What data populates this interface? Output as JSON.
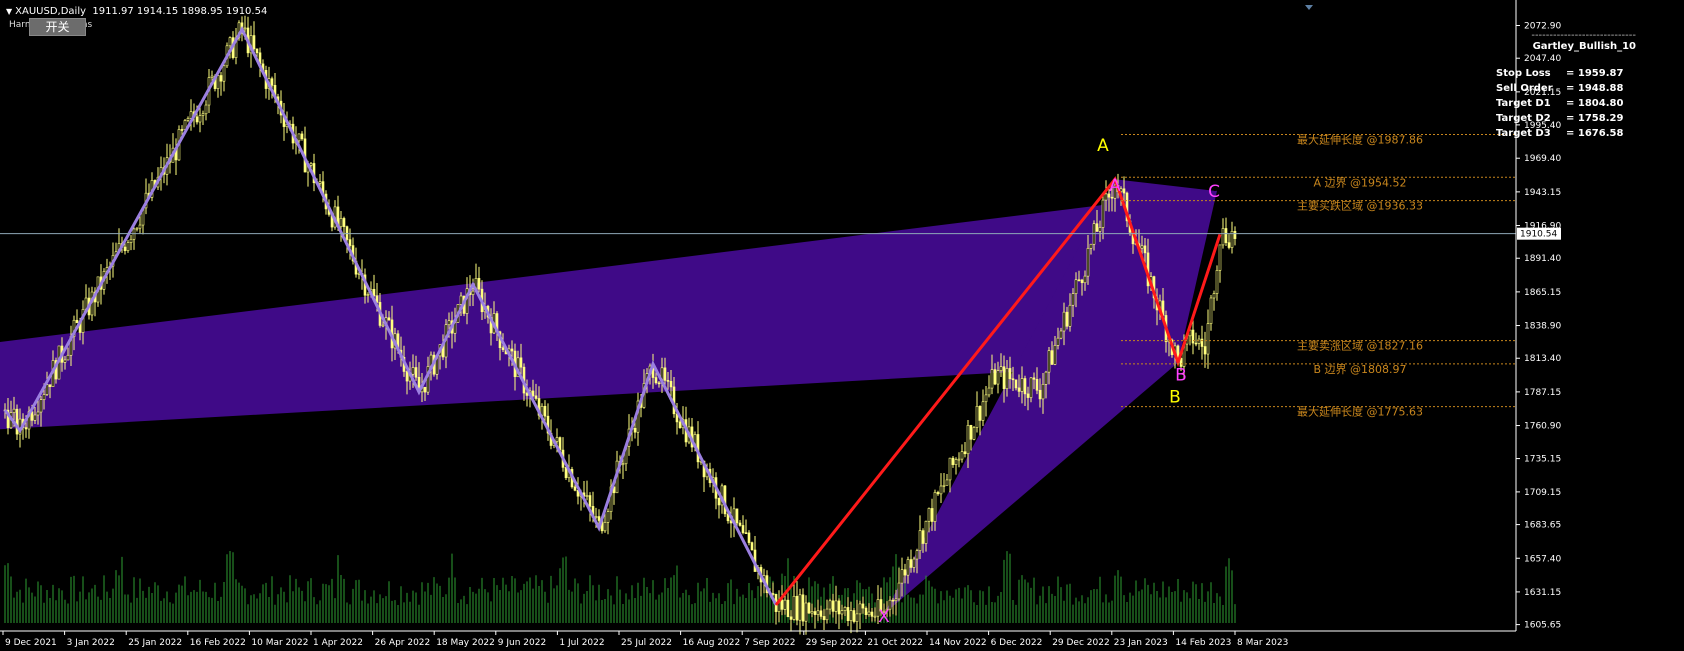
{
  "header": {
    "symbol": "XAUUSD,Daily",
    "ohlc": "1911.97 1914.15 1898.95 1910.54",
    "indicator": "Harmonic Patterns",
    "toggle_button": "开关"
  },
  "info_panel": {
    "dashes": "-----------------------------",
    "title": "Gartley_Bullish_10",
    "rows": [
      {
        "label": "Stop Loss",
        "value": "= 1959.87"
      },
      {
        "label": "Sell Order",
        "value": "= 1948.88"
      },
      {
        "label": "Target D1",
        "value": "= 1804.80"
      },
      {
        "label": "Target D2",
        "value": "= 1758.29"
      },
      {
        "label": "Target D3",
        "value": "= 1676.58"
      }
    ]
  },
  "colors": {
    "background": "#000000",
    "candle": "#ffff80",
    "volume": "#2e9e32",
    "zigzag": "#9b7fe0",
    "triangle_fill": "#3f0a87",
    "pattern_line": "#ff1a1a",
    "level_text": "#c8861d",
    "point_yellow": "#ffff00",
    "point_magenta": "#ff40ff"
  },
  "chart_data": {
    "type": "candlestick",
    "ylim": [
      1603,
      2085
    ],
    "y_ticks": [
      "2072.90",
      "2047.40",
      "2021.15",
      "1995.40",
      "1969.40",
      "1943.15",
      "1916.90",
      "1891.40",
      "1865.15",
      "1838.90",
      "1813.40",
      "1787.15",
      "1760.90",
      "1735.15",
      "1709.15",
      "1683.65",
      "1657.40",
      "1631.15",
      "1605.65"
    ],
    "current_price": "1910.54",
    "x_labels": [
      "9 Dec 2021",
      "3 Jan 2022",
      "25 Jan 2022",
      "16 Feb 2022",
      "10 Mar 2022",
      "1 Apr 2022",
      "26 Apr 2022",
      "18 May 2022",
      "9 Jun 2022",
      "1 Jul 2022",
      "25 Jul 2022",
      "16 Aug 2022",
      "7 Sep 2022",
      "29 Sep 2022",
      "21 Oct 2022",
      "14 Nov 2022",
      "6 Dec 2022",
      "29 Dec 2022",
      "23 Jan 2023",
      "14 Feb 2023",
      "8 Mar 2023"
    ],
    "zigzag": [
      {
        "bar": 0,
        "price": 1773
      },
      {
        "bar": 5,
        "price": 1757
      },
      {
        "bar": 79,
        "price": 2070
      },
      {
        "bar": 138,
        "price": 1787
      },
      {
        "bar": 156,
        "price": 1871
      },
      {
        "bar": 198,
        "price": 1681
      },
      {
        "bar": 216,
        "price": 1809
      },
      {
        "bar": 257,
        "price": 1621
      }
    ],
    "pattern": {
      "X": {
        "bar": 293,
        "price": 1614
      },
      "A": {
        "bar": 370,
        "price": 1953
      },
      "B": {
        "bar": 391,
        "price": 1810
      },
      "C": {
        "bar": 403,
        "price": 1944
      },
      "D": {
        "bar": 405,
        "price": 1910
      }
    },
    "red_line": [
      {
        "bar": 257,
        "price": 1621
      },
      {
        "bar": 370,
        "price": 1953
      },
      {
        "bar": 391,
        "price": 1810
      },
      {
        "bar": 405,
        "price": 1910
      }
    ],
    "levels": [
      {
        "label": "最大延伸长度 @1987.86",
        "price": 1987.86
      },
      {
        "label": "A 边界 @1954.52",
        "price": 1954.52
      },
      {
        "label": "主要买跌区域 @1936.33",
        "price": 1936.33
      },
      {
        "label": "主要卖涨区域 @1827.16",
        "price": 1827.16
      },
      {
        "label": "B 边界 @1808.97",
        "price": 1808.97
      },
      {
        "label": "最大延伸长度 @1775.63",
        "price": 1775.63
      }
    ],
    "point_labels": {
      "A_top": "A",
      "A_marker": "A",
      "B_marker": "B",
      "B_bottom": "B",
      "C": "C",
      "X": "X"
    },
    "volume_range": [
      0,
      100
    ]
  }
}
